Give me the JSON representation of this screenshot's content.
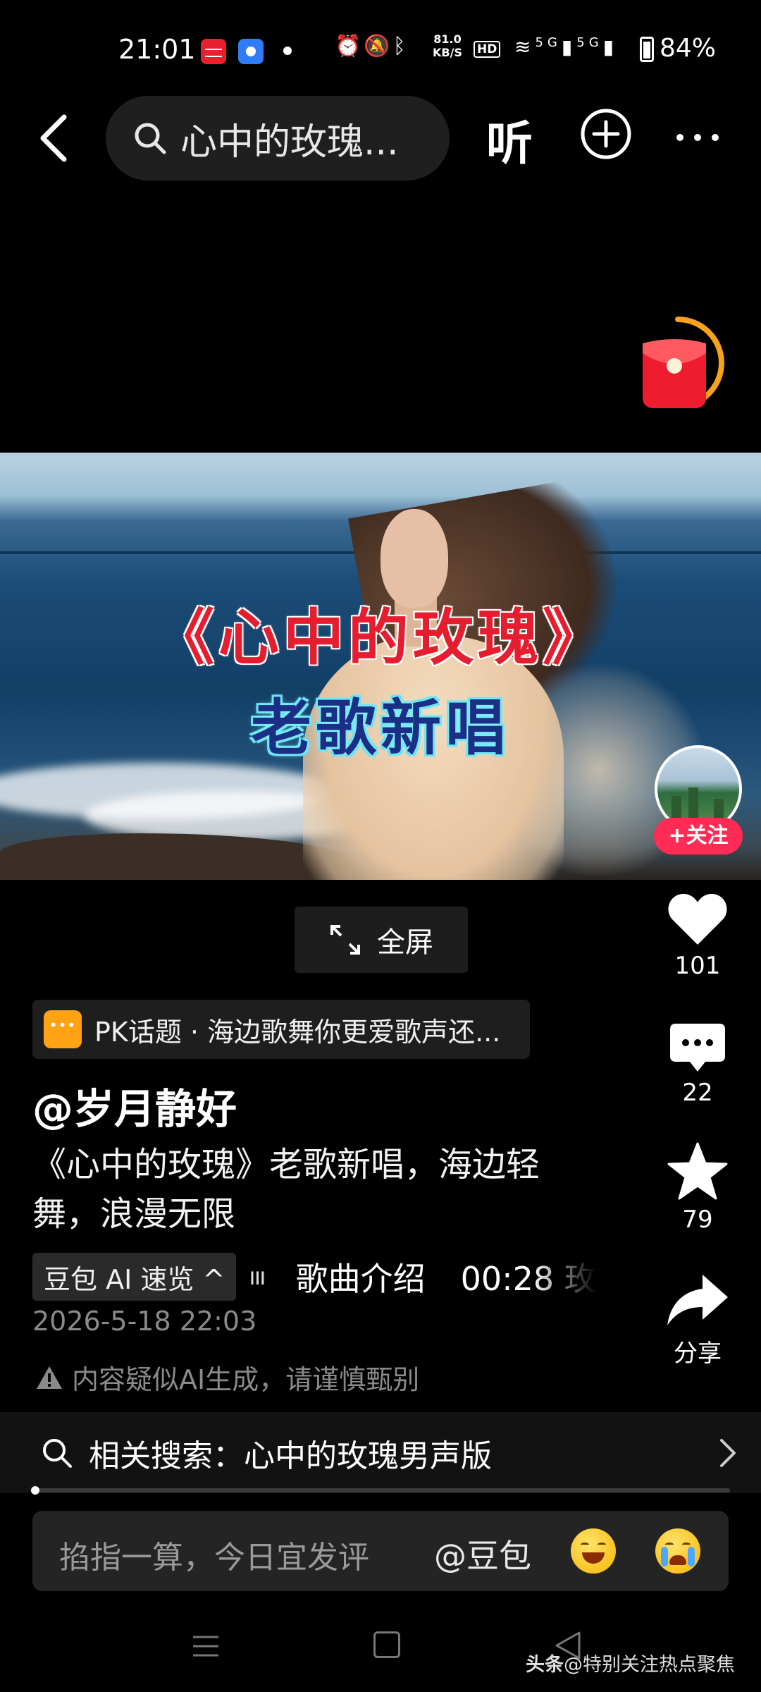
{
  "status_bar": {
    "time": "21:01",
    "network_speed_value": "81.0",
    "network_speed_unit": "KB/S",
    "hd_badge": "HD",
    "signal_1": "5G",
    "signal_2": "5G",
    "battery": "84%",
    "icons": [
      "alarm-icon",
      "mute-icon",
      "bluetooth-icon",
      "wifi-icon"
    ]
  },
  "top_bar": {
    "search_query": "心中的玫瑰...",
    "listen_label": "听"
  },
  "video": {
    "title_line1": "《心中的玫瑰》",
    "title_line2": "老歌新唱"
  },
  "follow": {
    "label": "+关注"
  },
  "fullscreen": {
    "label": "全屏"
  },
  "actions": {
    "likes": "101",
    "comments": "22",
    "favorites": "79",
    "share": "分享"
  },
  "pk_topic": {
    "text": "PK话题 · 海边歌舞你更爱歌声还..."
  },
  "post": {
    "author": "@岁月静好",
    "description": "《心中的玫瑰》老歌新唱，海边轻舞，浪漫无限",
    "ai_chip": "豆包 AI 速览 ^",
    "song_intro": "歌曲介绍",
    "timestamp_chip": "00:28 玫",
    "date": "2026-5-18 22:03",
    "ai_warning": "内容疑似AI生成，请谨慎甄别"
  },
  "related_search": {
    "text": "相关搜索：心中的玫瑰男声版"
  },
  "progress": {
    "fraction": 0.004
  },
  "comment_bar": {
    "placeholder": "掐指一算，今日宜发评",
    "mention": "@豆包",
    "emojis": [
      "grinning-squint-emoji",
      "loudly-crying-emoji"
    ]
  },
  "watermark": {
    "brand": "头条",
    "handle": "@特别关注热点聚焦"
  },
  "colors": {
    "background": "#000000",
    "follow_red": "#fe2c55",
    "pk_orange": "#ffa214",
    "title_red": "#e61d2f",
    "redpacket_orange": "#f7a21b"
  }
}
